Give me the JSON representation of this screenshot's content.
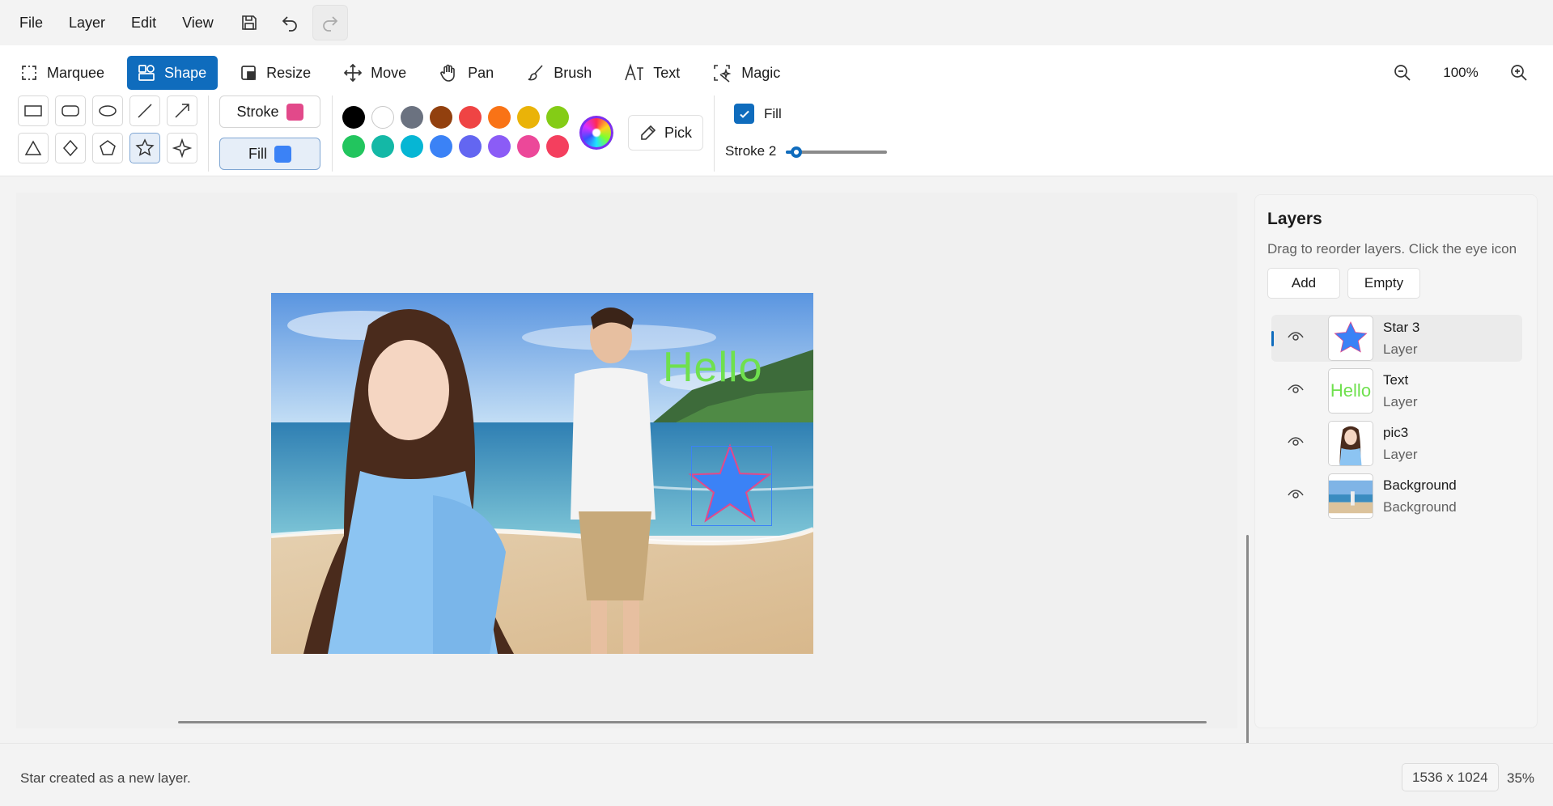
{
  "menubar": {
    "items": [
      "File",
      "Layer",
      "Edit",
      "View"
    ],
    "icons": [
      "save-icon",
      "undo-icon",
      "redo-icon"
    ]
  },
  "toolbar": {
    "tools": [
      {
        "label": "Marquee",
        "icon": "marquee-icon",
        "active": false
      },
      {
        "label": "Shape",
        "icon": "shapes-icon",
        "active": true
      },
      {
        "label": "Resize",
        "icon": "resize-icon",
        "active": false
      },
      {
        "label": "Move",
        "icon": "move-icon",
        "active": false
      },
      {
        "label": "Pan",
        "icon": "hand-icon",
        "active": false
      },
      {
        "label": "Brush",
        "icon": "brush-icon",
        "active": false
      },
      {
        "label": "Text",
        "icon": "text-icon",
        "active": false
      },
      {
        "label": "Magic",
        "icon": "magic-wand-icon",
        "active": false
      }
    ],
    "zoom_label": "100%"
  },
  "shape_options": {
    "shapes": [
      "rectangle",
      "rounded-rectangle",
      "ellipse",
      "line",
      "arrow",
      "triangle",
      "diamond",
      "pentagon",
      "star",
      "sparkle"
    ],
    "selected_shape": "star",
    "stroke_label": "Stroke",
    "stroke_color": "#e2498a",
    "fill_label": "Fill",
    "fill_color": "#3b82f6",
    "palette": [
      "#000000",
      "#ffffff",
      "#6b7280",
      "#92400e",
      "#ef4444",
      "#f97316",
      "#eab308",
      "#84cc16",
      "#22c55e",
      "#14b8a6",
      "#06b6d4",
      "#3b82f6",
      "#6366f1",
      "#8b5cf6",
      "#ec4899",
      "#f43f5e"
    ],
    "pick_label": "Pick",
    "fill_checkbox_label": "Fill",
    "fill_checked": true,
    "stroke_width_label": "Stroke 2",
    "stroke_width_value": 2,
    "stroke_width_max": 20
  },
  "canvas": {
    "hello_text": "Hello",
    "hello_color": "#6fe04e"
  },
  "layers": {
    "title": "Layers",
    "hint": "Drag to reorder layers. Click the eye icon",
    "add_label": "Add",
    "empty_label": "Empty",
    "items": [
      {
        "name": "Star 3",
        "type": "Layer",
        "thumb": "star",
        "selected": true
      },
      {
        "name": "Text",
        "type": "Layer",
        "thumb": "text",
        "selected": false
      },
      {
        "name": "pic3",
        "type": "Layer",
        "thumb": "portrait",
        "selected": false
      },
      {
        "name": "Background",
        "type": "Background",
        "thumb": "beach",
        "selected": false
      }
    ],
    "thumb_text": "Hello"
  },
  "status": {
    "message": "Star created as a new layer.",
    "dimensions": "1536 x 1024",
    "zoom": "35%"
  }
}
